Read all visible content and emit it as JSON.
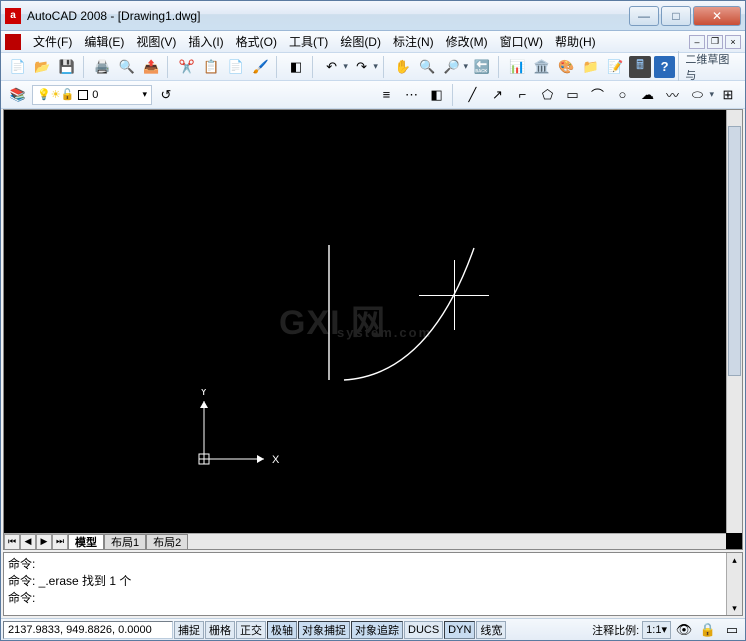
{
  "window": {
    "title": "AutoCAD 2008 - [Drawing1.dwg]",
    "app_icon_letter": "a"
  },
  "menu": {
    "items": [
      "文件(F)",
      "编辑(E)",
      "视图(V)",
      "插入(I)",
      "格式(O)",
      "工具(T)",
      "绘图(D)",
      "标注(N)",
      "修改(M)",
      "窗口(W)",
      "帮助(H)"
    ]
  },
  "toolbar1": {
    "side_label": "二维草图与"
  },
  "layerbar": {
    "layer_name": "0"
  },
  "canvas": {
    "axis_x": "X",
    "axis_y": "Y",
    "watermark_main": "GXI 网",
    "watermark_sub": "system.com"
  },
  "tabs": {
    "model": "模型",
    "layout1": "布局1",
    "layout2": "布局2"
  },
  "command": {
    "line1": "命令:",
    "line2": "命令: _.erase 找到 1 个",
    "line3": "命令:"
  },
  "status": {
    "coords": "2137.9833, 949.8826, 0.0000",
    "snap": "捕捉",
    "grid": "栅格",
    "ortho": "正交",
    "polar": "极轴",
    "osnap": "对象捕捉",
    "otrack": "对象追踪",
    "ducs": "DUCS",
    "dyn": "DYN",
    "lwt": "线宽",
    "annoscale_label": "注释比例:",
    "annoscale_value": "1:1"
  }
}
